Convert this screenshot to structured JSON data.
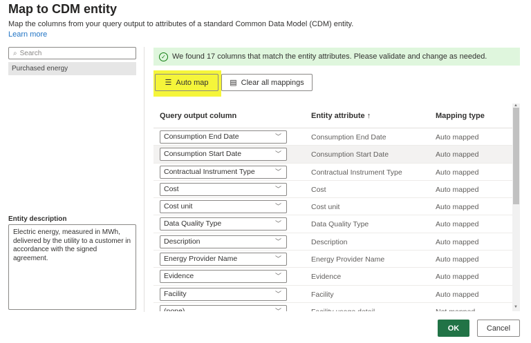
{
  "title": "Map to CDM entity",
  "subtitle": "Map the columns from your query output to attributes of a standard Common Data Model (CDM) entity.",
  "learn_more": "Learn more",
  "left": {
    "search_placeholder": "Search",
    "entity": "Purchased energy",
    "desc_label": "Entity description",
    "description": "Electric energy, measured in MWh, delivered by the utility to a customer in accordance with the signed agreement."
  },
  "banner": "We found 17 columns that match the entity attributes. Please validate and change as needed.",
  "toolbar": {
    "auto_map": "Auto map",
    "clear_all": "Clear all mappings"
  },
  "columns": {
    "query": "Query output column",
    "attribute": "Entity attribute",
    "sort": "↑",
    "mapping": "Mapping type"
  },
  "rows": [
    {
      "query": "Consumption End Date",
      "attribute": "Consumption End Date",
      "mapping": "Auto mapped"
    },
    {
      "query": "Consumption Start Date",
      "attribute": "Consumption Start Date",
      "mapping": "Auto mapped"
    },
    {
      "query": "Contractual Instrument Type",
      "attribute": "Contractual Instrument Type",
      "mapping": "Auto mapped"
    },
    {
      "query": "Cost",
      "attribute": "Cost",
      "mapping": "Auto mapped"
    },
    {
      "query": "Cost unit",
      "attribute": "Cost unit",
      "mapping": "Auto mapped"
    },
    {
      "query": "Data Quality Type",
      "attribute": "Data Quality Type",
      "mapping": "Auto mapped"
    },
    {
      "query": "Description",
      "attribute": "Description",
      "mapping": "Auto mapped"
    },
    {
      "query": "Energy Provider Name",
      "attribute": "Energy Provider Name",
      "mapping": "Auto mapped"
    },
    {
      "query": "Evidence",
      "attribute": "Evidence",
      "mapping": "Auto mapped"
    },
    {
      "query": "Facility",
      "attribute": "Facility",
      "mapping": "Auto mapped"
    },
    {
      "query": "(none)",
      "attribute": "Facility usage detail",
      "mapping": "Not mapped"
    }
  ],
  "footer": {
    "ok": "OK",
    "cancel": "Cancel"
  },
  "colors": {
    "banner": "#dff6dd",
    "ok": "#217346",
    "highlight": "#f5f53a",
    "link": "#1f73c4"
  }
}
